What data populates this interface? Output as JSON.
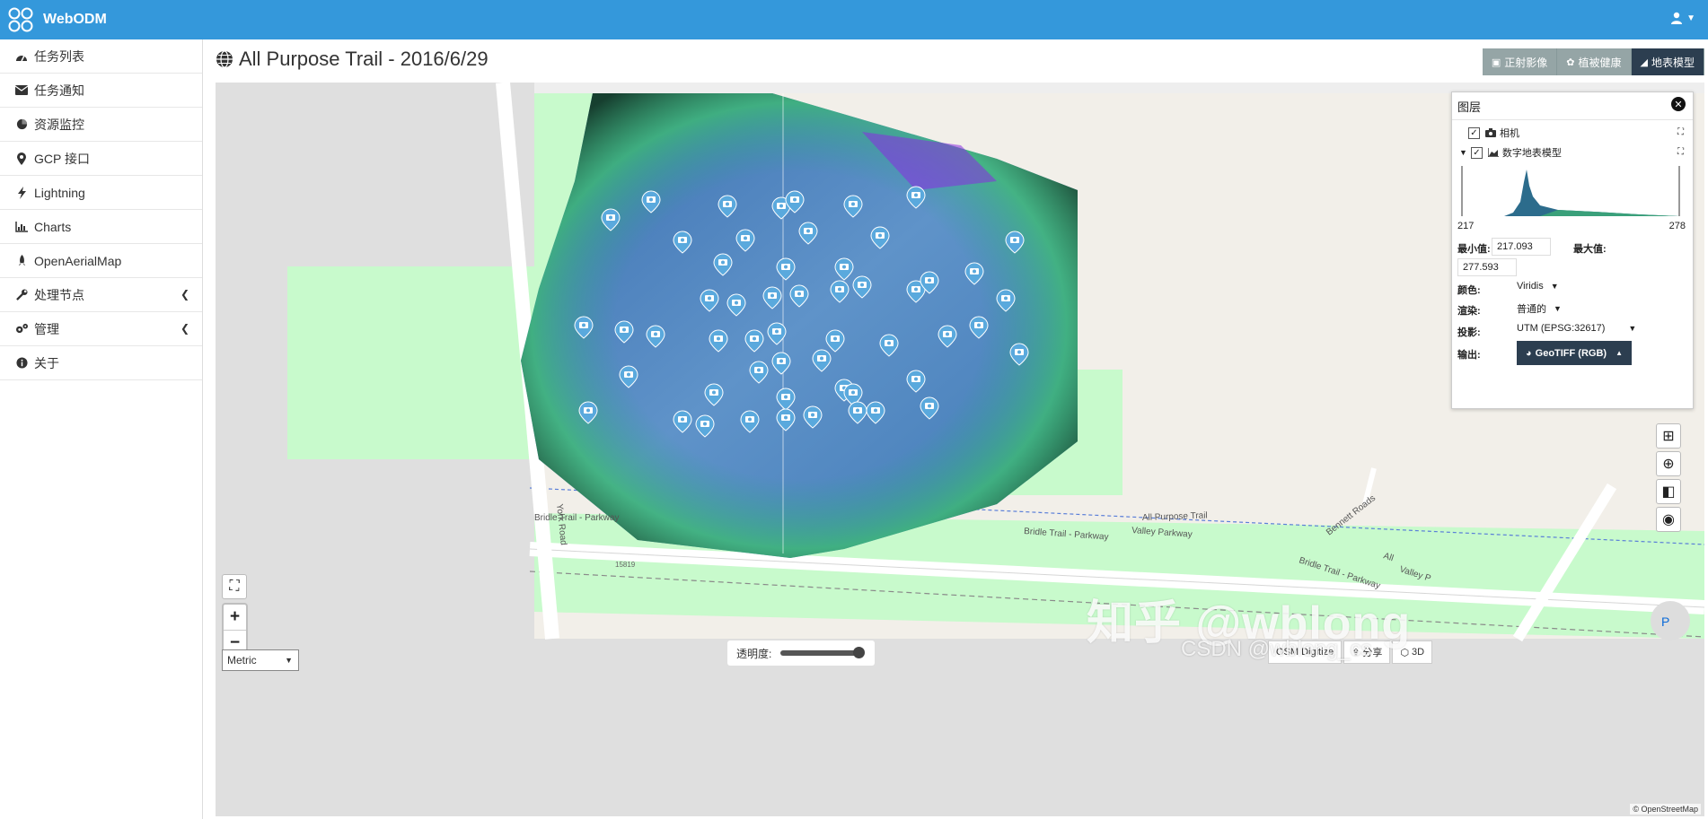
{
  "app": {
    "title": "WebODM"
  },
  "sidebar": {
    "items": [
      {
        "label": "任务列表",
        "icon": "dashboard-icon"
      },
      {
        "label": "任务通知",
        "icon": "envelope-icon"
      },
      {
        "label": "资源监控",
        "icon": "pie-chart-icon"
      },
      {
        "label": "GCP 接口",
        "icon": "map-marker-icon"
      },
      {
        "label": "Lightning",
        "icon": "bolt-icon"
      },
      {
        "label": "Charts",
        "icon": "bar-chart-icon"
      },
      {
        "label": "OpenAerialMap",
        "icon": "rocket-icon"
      },
      {
        "label": "处理节点",
        "icon": "wrench-icon",
        "chevron": true
      },
      {
        "label": "管理",
        "icon": "gears-icon",
        "chevron": true
      },
      {
        "label": "关于",
        "icon": "info-icon"
      }
    ]
  },
  "page": {
    "title": "All Purpose Trail - 2016/6/29"
  },
  "view_tabs": [
    {
      "label": "正射影像",
      "icon": "image-icon",
      "active": false
    },
    {
      "label": "植被健康",
      "icon": "plant-icon",
      "active": false
    },
    {
      "label": "地表模型",
      "icon": "area-chart-icon",
      "active": true
    }
  ],
  "layers": {
    "title": "图层",
    "camera_label": "相机",
    "dsm_label": "数字地表模型",
    "hist_min_tick": "217",
    "hist_max_tick": "278",
    "min_label": "最小值:",
    "min_value": "217.093",
    "max_label": "最大值:",
    "max_value": "277.593",
    "color_label": "颜色:",
    "color_value": "Viridis",
    "render_label": "渲染:",
    "render_value": "普通的",
    "projection_label": "投影:",
    "projection_value": "UTM (EPSG:32617)",
    "export_label": "输出:",
    "export_value": "GeoTIFF (RGB)"
  },
  "map": {
    "streets": {
      "york_road": "York Road",
      "bridle_left": "Bridle Trail - Parkway",
      "bridle_mid": "Bridle Trail - Parkway",
      "valley_parkway": "Valley Parkway",
      "all_purpose": "All Purpose Trail",
      "bennett": "Bennett Roads",
      "bridle_right": "Bridle Trail - Parkway",
      "all_right": "All",
      "valley_right": "Valley P",
      "house_no": "15819"
    },
    "unit_value": "Metric",
    "opacity_label": "透明度:",
    "opacity_percent": 100,
    "bottom_tools": [
      "OSM Digitize",
      "分享",
      "3D"
    ],
    "attribution": "© OpenStreetMap"
  },
  "watermark": {
    "main": "知乎 @wblong",
    "sub": "CSDN @wblong_cs"
  },
  "colors": {
    "topbar": "#3498db",
    "tab_active": "#2c3e50",
    "tab_inactive": "#95a5a6",
    "park": "#c8facc"
  }
}
